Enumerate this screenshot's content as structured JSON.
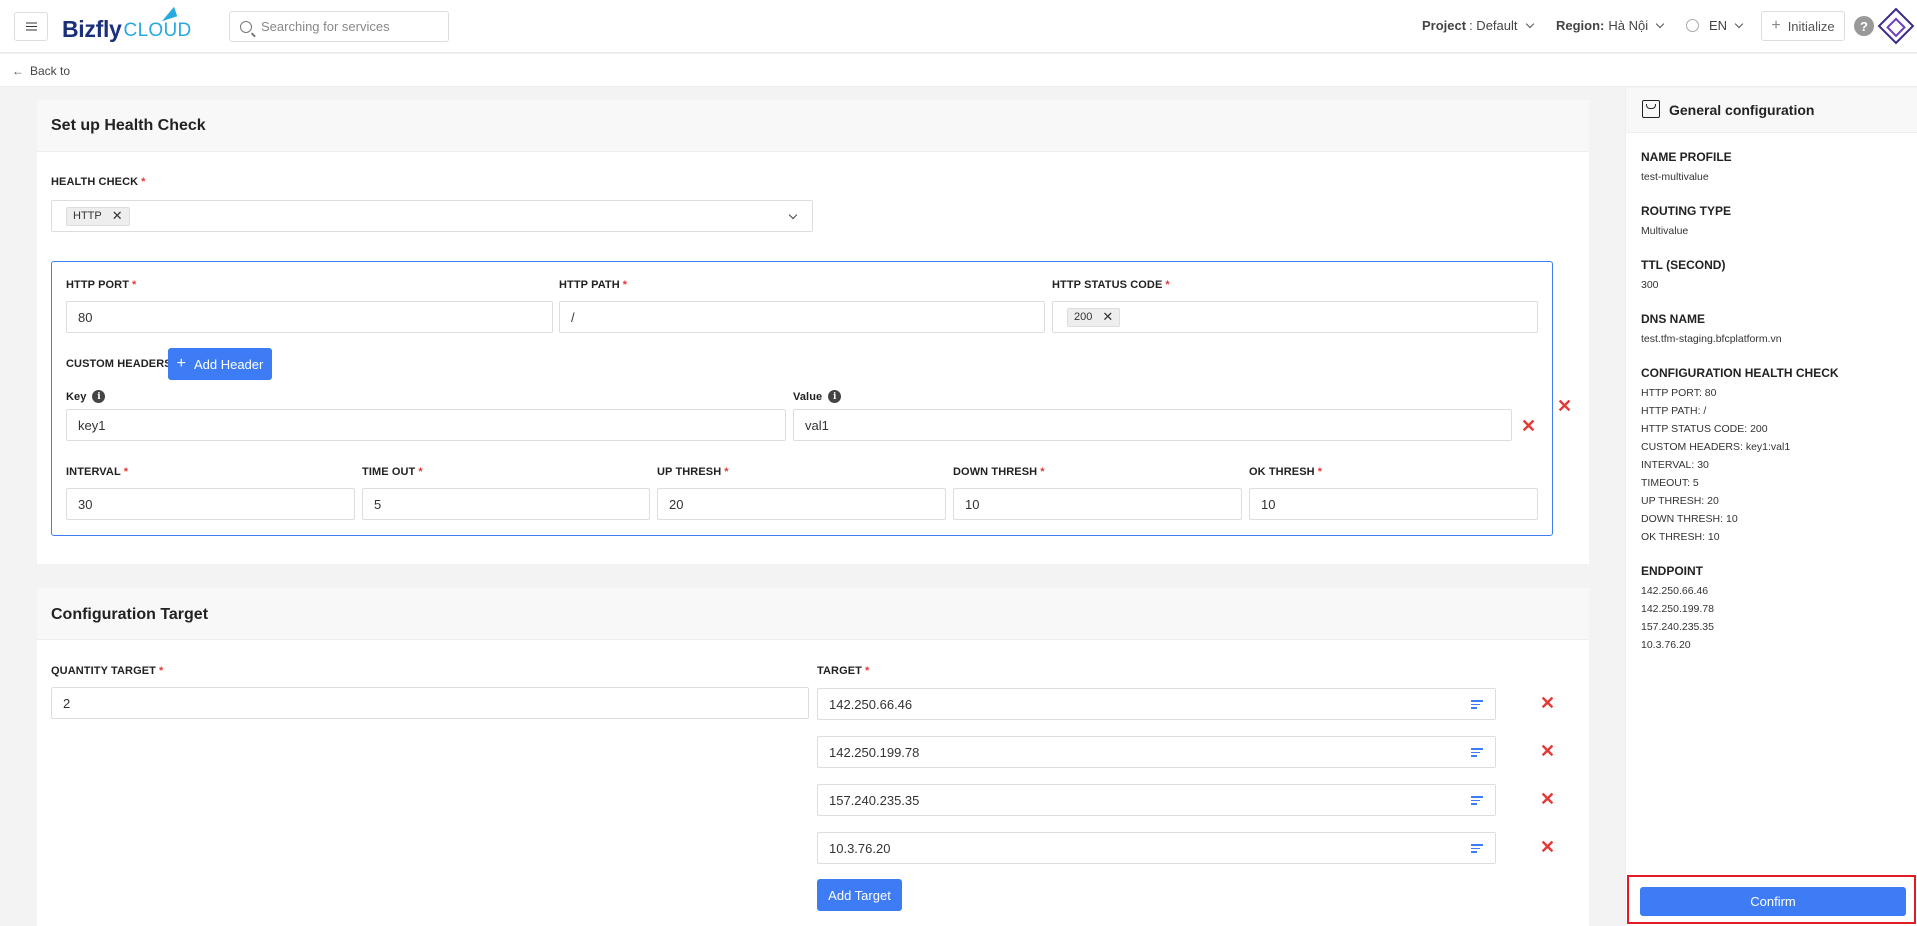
{
  "header": {
    "logo_main": "Bizfly",
    "logo_sub": "CLOUD",
    "search_placeholder": "Searching for services",
    "project_label": "Project",
    "project_value": ": Default",
    "region_label": "Region:",
    "region_value": "Hà Nội",
    "language": "EN",
    "initialize_label": "Initialize",
    "help": "?"
  },
  "back": {
    "label": "Back to"
  },
  "health_check": {
    "title": "Set up Health Check",
    "health_check_label": "HEALTH CHECK",
    "health_check_tag": "HTTP",
    "http_port_label": "HTTP PORT",
    "http_port_value": "80",
    "http_path_label": "HTTP PATH",
    "http_path_value": "/",
    "http_status_label": "HTTP STATUS CODE",
    "http_status_tag": "200",
    "custom_headers_label": "CUSTOM HEADERS",
    "add_header_label": "Add Header",
    "key_label": "Key",
    "key_value": "key1",
    "value_label": "Value",
    "value_value": "val1",
    "interval_label": "INTERVAL",
    "interval_value": "30",
    "timeout_label": "TIME OUT",
    "timeout_value": "5",
    "up_thresh_label": "UP THRESH",
    "up_thresh_value": "20",
    "down_thresh_label": "DOWN THRESH",
    "down_thresh_value": "10",
    "ok_thresh_label": "OK THRESH",
    "ok_thresh_value": "10",
    "required_mark": "*"
  },
  "target": {
    "title": "Configuration Target",
    "quantity_label": "QUANTITY TARGET",
    "quantity_value": "2",
    "target_label": "TARGET",
    "targets": [
      "142.250.66.46",
      "142.250.199.78",
      "157.240.235.35",
      "10.3.76.20"
    ],
    "add_target_label": "Add Target"
  },
  "summary": {
    "title": "General configuration",
    "name_profile_label": "NAME PROFILE",
    "name_profile_value": "test-multivalue",
    "routing_type_label": "ROUTING TYPE",
    "routing_type_value": "Multivalue",
    "ttl_label": "TTL (SECOND)",
    "ttl_value": "300",
    "dns_name_label": "DNS NAME",
    "dns_name_value": "test.tfm-staging.bfcplatform.vn",
    "config_hc_label": "CONFIGURATION HEALTH CHECK",
    "config_hc_lines": [
      "HTTP PORT: 80",
      "HTTP PATH: /",
      "HTTP STATUS CODE: 200",
      "CUSTOM HEADERS: key1:val1",
      "INTERVAL: 30",
      "TIMEOUT: 5",
      "UP THRESH: 20",
      "DOWN THRESH: 10",
      "OK THRESH: 10"
    ],
    "endpoint_label": "ENDPOINT",
    "endpoints": [
      "142.250.66.46",
      "142.250.199.78",
      "157.240.235.35",
      "10.3.76.20"
    ],
    "confirm_label": "Confirm"
  },
  "colors": {
    "primary": "#3d7cf4",
    "danger": "#e53935",
    "highlight": "#e01b24"
  }
}
